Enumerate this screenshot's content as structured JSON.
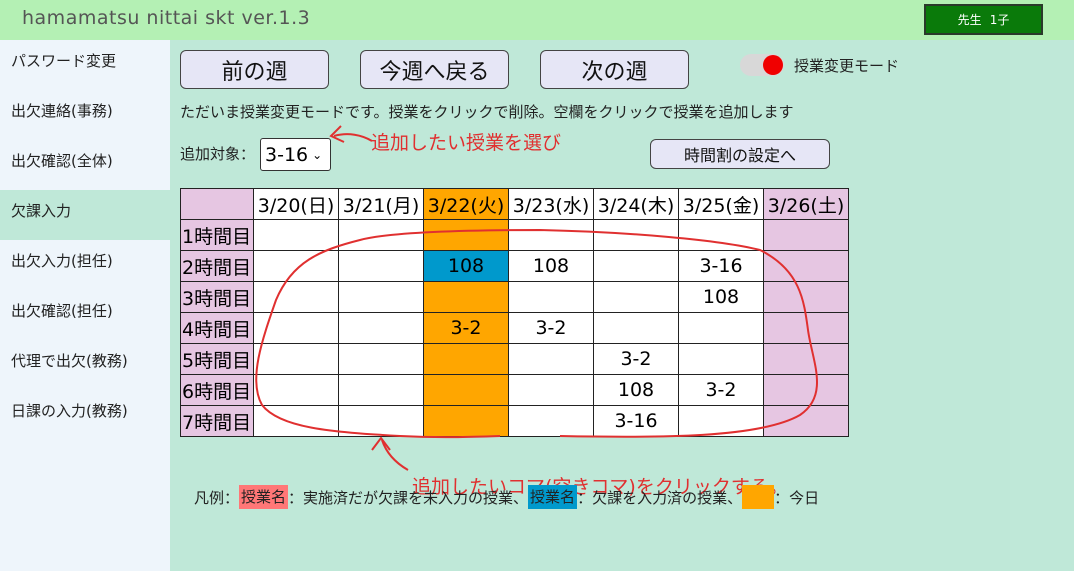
{
  "header": {
    "app_title": "hamamatsu nittai skt ver.1.3",
    "user_role": "先生",
    "user_name": "1子"
  },
  "sidebar": {
    "items": [
      {
        "label": "パスワード変更"
      },
      {
        "label": "出欠連絡(事務)"
      },
      {
        "label": "出欠確認(全体)"
      },
      {
        "label": "欠課入力",
        "active": true
      },
      {
        "label": "出欠入力(担任)"
      },
      {
        "label": "出欠確認(担任)"
      },
      {
        "label": "代理で出欠(教務)"
      },
      {
        "label": "日課の入力(教務)"
      }
    ]
  },
  "toolbar": {
    "prev_week": "前の週",
    "this_week": "今週へ戻る",
    "next_week": "次の週",
    "mode_label": "授業変更モード",
    "mode_on": true
  },
  "info_text": "ただいま授業変更モードです。授業をクリックで削除。空欄をクリックで授業を追加します",
  "target": {
    "label": "追加対象：",
    "selected": "3-16"
  },
  "timetable_setting_button": "時間割の設定へ",
  "timetable": {
    "days": [
      "3/20(日)",
      "3/21(月)",
      "3/22(火)",
      "3/23(水)",
      "3/24(木)",
      "3/25(金)",
      "3/26(土)"
    ],
    "periods": [
      {
        "label": "1時間目",
        "cells": [
          "",
          "",
          "",
          "",
          "",
          "",
          ""
        ]
      },
      {
        "label": "2時間目",
        "cells": [
          "",
          "",
          "108",
          "108",
          "",
          "3-16",
          ""
        ]
      },
      {
        "label": "3時間目",
        "cells": [
          "",
          "",
          "",
          "",
          "",
          "108",
          ""
        ]
      },
      {
        "label": "4時間目",
        "cells": [
          "",
          "",
          "3-2",
          "3-2",
          "",
          "",
          ""
        ]
      },
      {
        "label": "5時間目",
        "cells": [
          "",
          "",
          "",
          "",
          "3-2",
          "",
          ""
        ]
      },
      {
        "label": "6時間目",
        "cells": [
          "",
          "",
          "",
          "",
          "108",
          "3-2",
          ""
        ]
      },
      {
        "label": "7時間目",
        "cells": [
          "",
          "",
          "",
          "",
          "3-16",
          "",
          ""
        ]
      }
    ]
  },
  "annotations": {
    "select_hint": "追加したい授業を選び",
    "click_hint": "追加したいコマ(空きコマ)をクリックする。"
  },
  "legend": {
    "prefix": "凡例：",
    "item1_chip": "授業名",
    "item1_text": "：実施済だが欠課を未入力の授業、",
    "item2_chip": "授業名",
    "item2_text": "：欠課を入力済の授業、",
    "item3_text": "：今日"
  },
  "colors": {
    "header_bg": "#b4f0b4",
    "main_bg": "#bfe8d8",
    "sidebar_bg": "#eef5fb",
    "today": "#ffa600",
    "weekend": "#e6c6e2",
    "entered": "#0099cc",
    "not_entered": "#ff7777",
    "annotation": "#e03030"
  }
}
